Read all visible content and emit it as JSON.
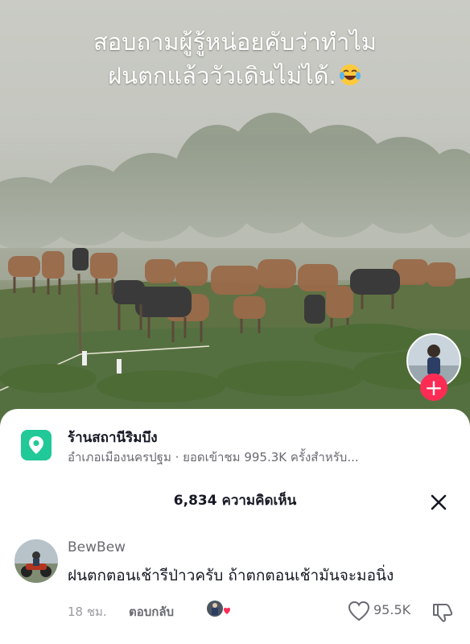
{
  "video": {
    "caption_line1": "สอบถามผู้รู้หน่อยคับว่าทำไม",
    "caption_line2": "ฝนตกแล้ววัวเดินไม่ได้.",
    "caption_emoji": "face-with-tears-of-joy-icon",
    "follow_symbol": "+"
  },
  "place": {
    "name": "ร้านสถานีริมบึง",
    "meta": "อำเภอเมืองนครปฐม · ยอดเข้าชม 995.3K ครั้งสำหรับ..."
  },
  "comments_panel": {
    "title": "6,834 ความคิดเห็น"
  },
  "comment": {
    "username": "BewBew",
    "text": "ฝนตกตอนเช้ารีป่าวครับ ถ้าตกตอนเช้ามันจะมอนิ่ง",
    "time": "18 ชม.",
    "reply_label": "ตอบกลับ",
    "like_count": "95.5K"
  },
  "colors": {
    "follow": "#fe2c55",
    "place_icon": "#20c997",
    "text_primary": "#161823",
    "text_secondary": "#6a6a72"
  }
}
